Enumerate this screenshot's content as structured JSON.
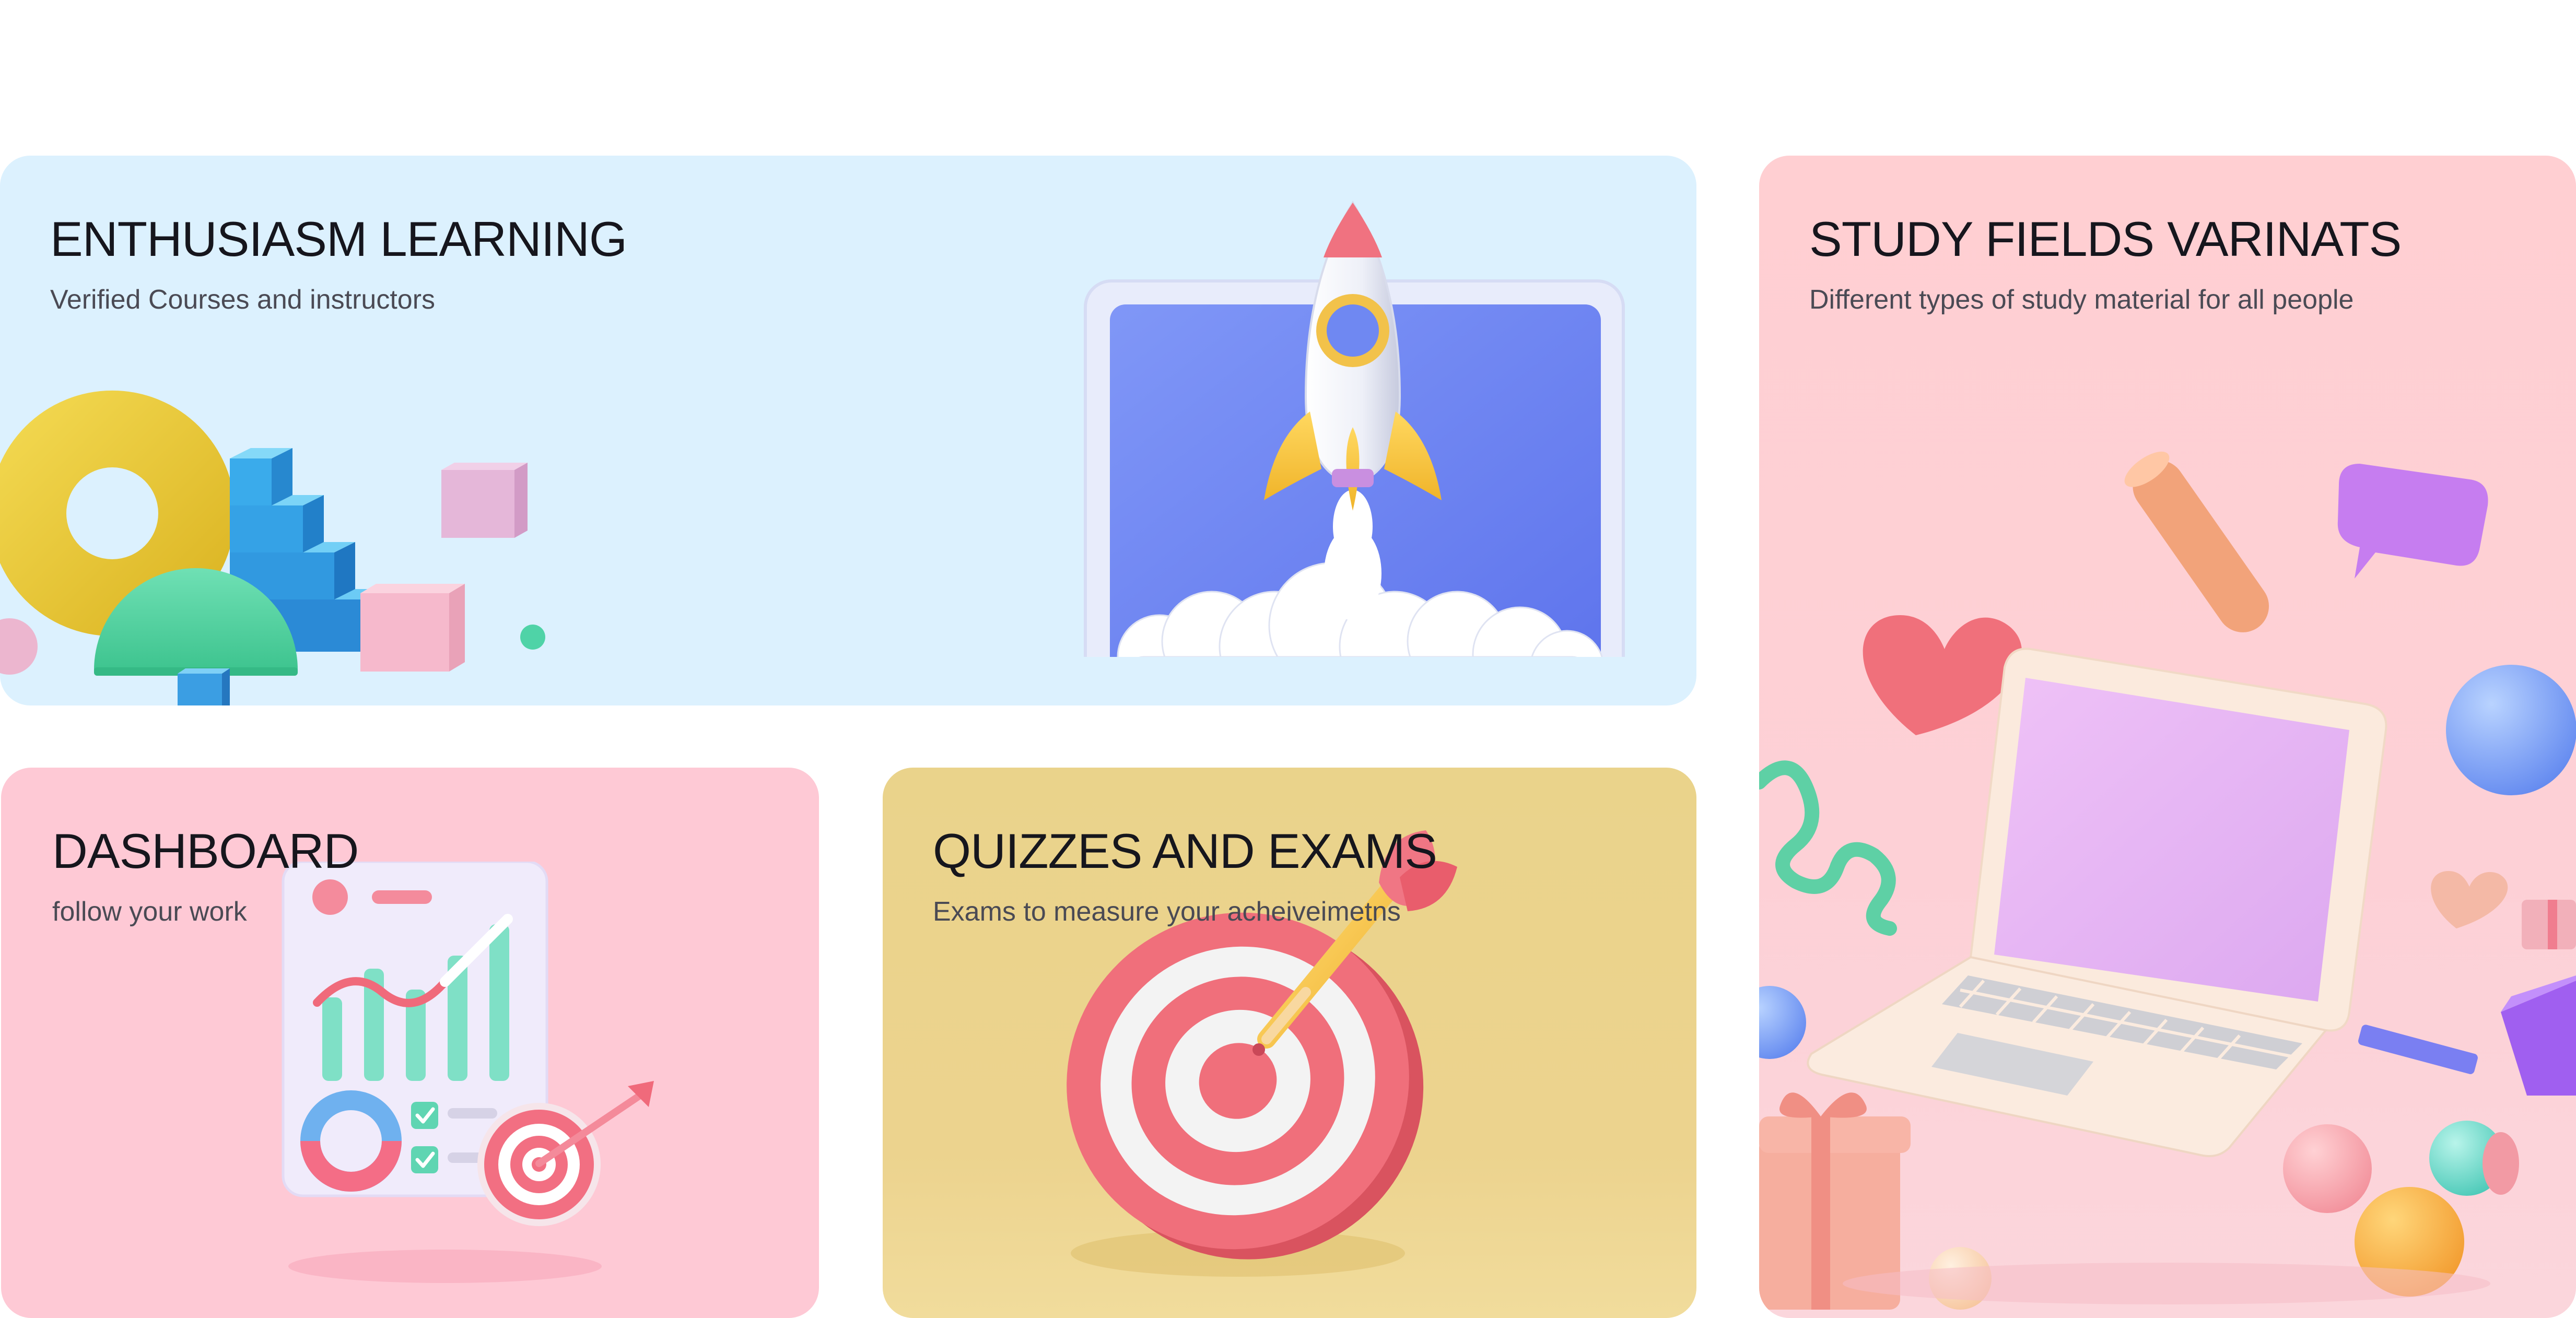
{
  "cards": {
    "enthusiasm": {
      "title": "ENTHUSIASM LEARNING",
      "subtitle": "Verified Courses and instructors"
    },
    "study_fields": {
      "title": "STUDY FIELDS VARINATS",
      "subtitle": "Different types of study material for all people"
    },
    "dashboard": {
      "title": "DASHBOARD",
      "subtitle": "follow your work"
    },
    "quizzes": {
      "title": "QUIZZES AND EXAMS",
      "subtitle": "Exams to measure your acheiveimetns"
    }
  },
  "colors": {
    "enthusiasm_bg": "#dcf1fe",
    "study_bg": "#ffcfd2",
    "dashboard_bg": "#fec9d5",
    "quizzes_bg": "#ead38b",
    "title_text": "#16161d",
    "subtitle_text": "#4a4a54"
  },
  "illustrations": {
    "enthusiasm": [
      "shapes-icon",
      "laptop-rocket-icon"
    ],
    "study_fields": [
      "floating-laptop-icon"
    ],
    "dashboard": [
      "report-chart-icon",
      "target-icon"
    ],
    "quizzes": [
      "dartboard-icon"
    ]
  }
}
